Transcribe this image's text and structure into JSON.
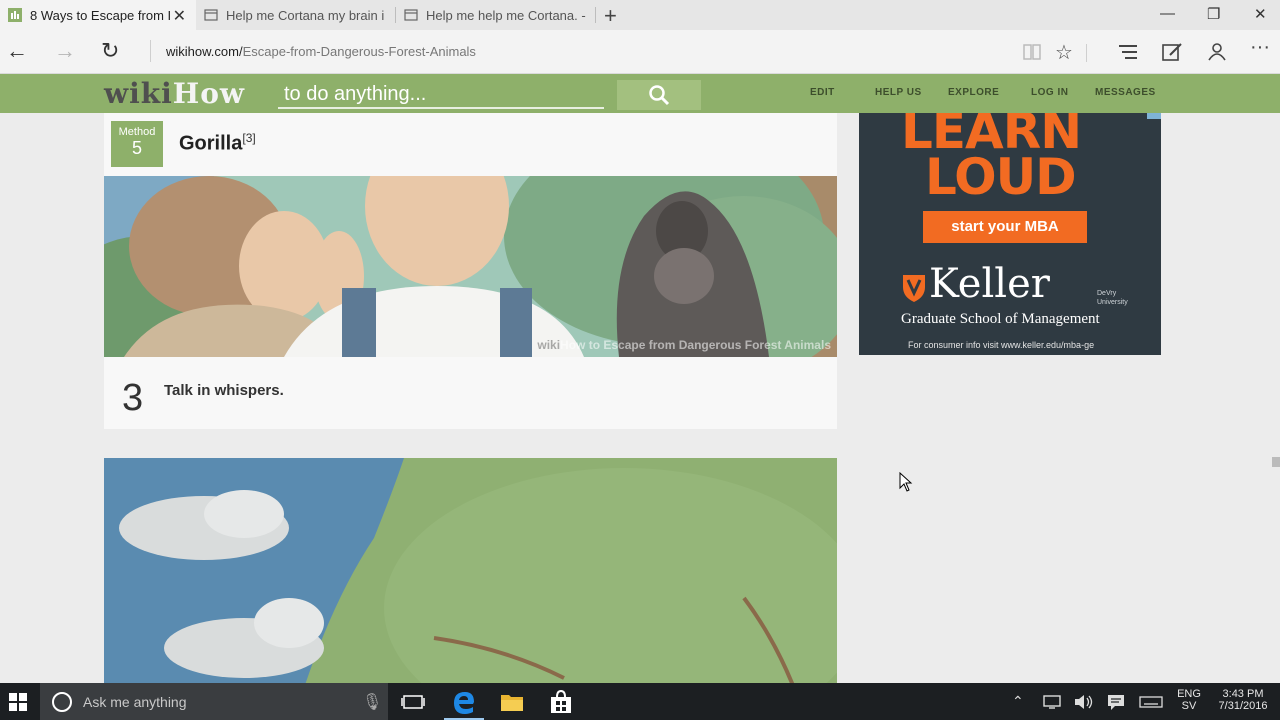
{
  "browser": {
    "tabs": [
      {
        "label": "8 Ways to Escape from I",
        "active": true
      },
      {
        "label": "Help me Cortana my brain i",
        "active": false
      },
      {
        "label": "Help me help me Cortana. -",
        "active": false
      }
    ],
    "url_host": "wikihow.com/",
    "url_path": "Escape-from-Dangerous-Forest-Animals"
  },
  "wikihow": {
    "logo_wiki": "wiki",
    "logo_how": "How",
    "search_placeholder": "to do anything...",
    "nav": [
      "EDIT",
      "HELP US",
      "EXPLORE",
      "LOG IN",
      "MESSAGES"
    ]
  },
  "article": {
    "method_label": "Method",
    "method_number": "5",
    "method_title": "Gorilla",
    "method_ref": "[3]",
    "watermark_wiki": "wiki",
    "watermark_text": "How to Escape from Dangerous Forest Animals",
    "step_number": "3",
    "step_text": "Talk in whispers."
  },
  "ad": {
    "headline_1": "LEARN",
    "headline_2": "LOUD",
    "cta": "start your MBA",
    "brand": "Keller",
    "brand_sub_1": "DeVry",
    "brand_sub_2": "University",
    "school": "Graduate School of Management",
    "info": "For consumer info visit www.keller.edu/mba-ge",
    "brand_color": "#f26b22"
  },
  "taskbar": {
    "search_placeholder": "Ask me anything",
    "lang_1": "ENG",
    "lang_2": "SV",
    "time": "3:43 PM",
    "date": "7/31/2016"
  },
  "icons": [
    "wikihow-favicon",
    "page-icon",
    "back-icon",
    "forward-icon",
    "refresh-icon",
    "reading-view-icon",
    "favorite-star-icon",
    "hub-icon",
    "web-note-icon",
    "share-icon",
    "more-icon",
    "search-icon",
    "windows-start-icon",
    "cortana-icon",
    "microphone-icon",
    "task-view-icon",
    "edge-icon",
    "file-explorer-icon",
    "store-icon"
  ]
}
